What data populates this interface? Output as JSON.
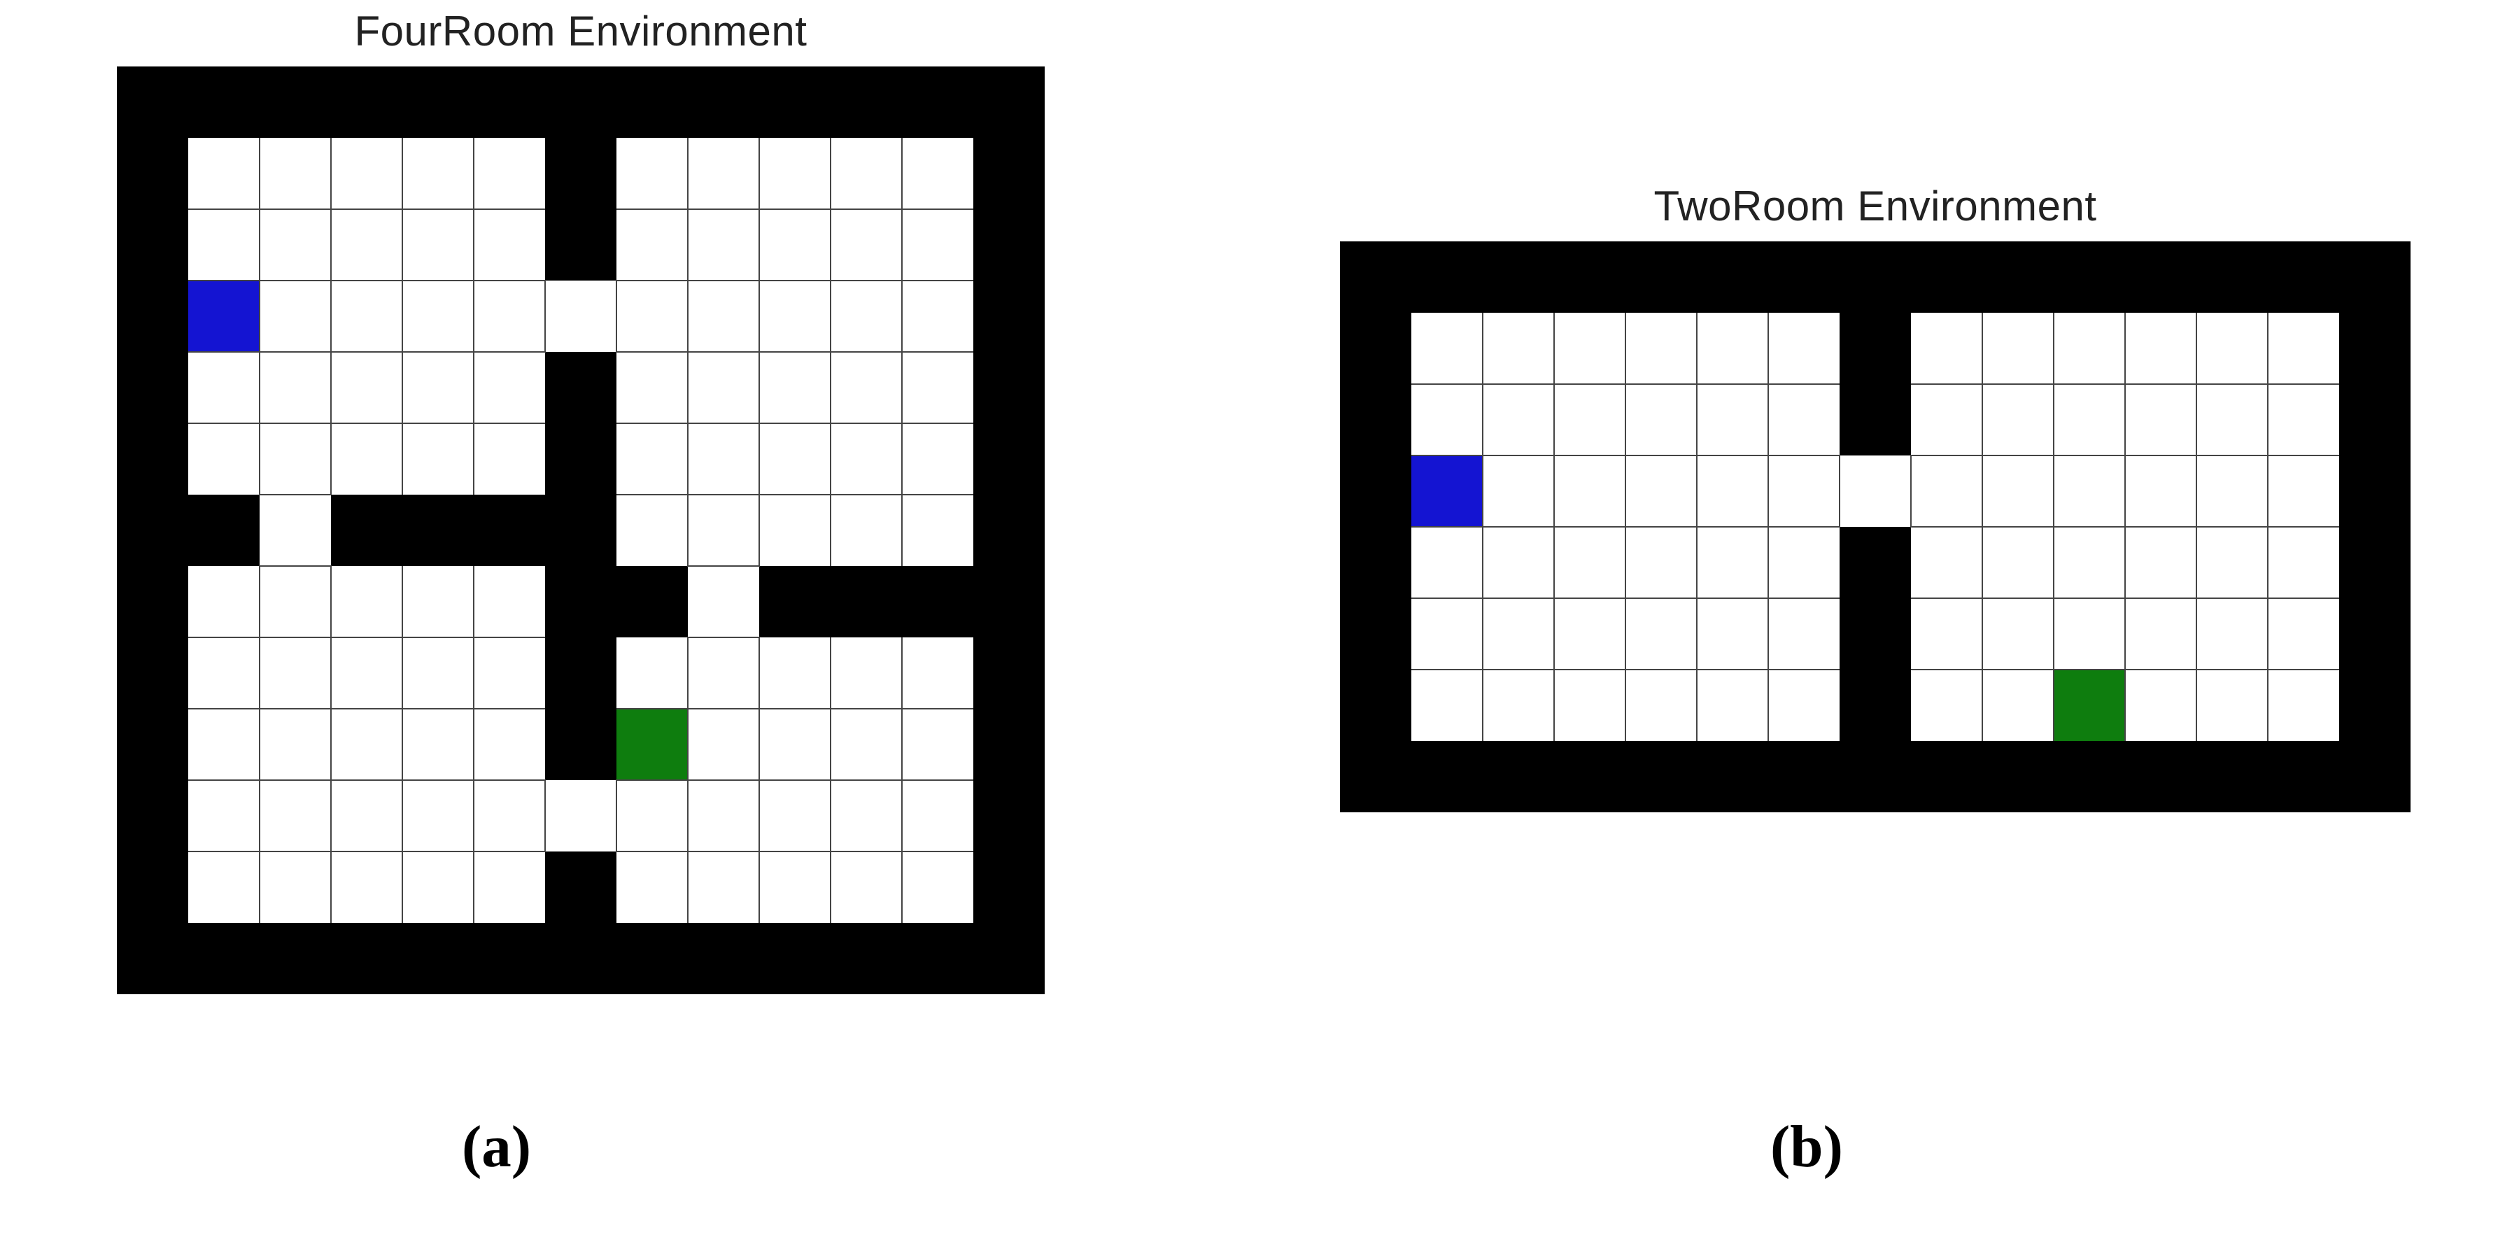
{
  "colors": {
    "wall": "#000000",
    "empty": "#ffffff",
    "agent": "#1414d2",
    "goal": "#0e7d0e",
    "grid_line": "#444444"
  },
  "panels": {
    "a": {
      "title": "FourRoom Environment",
      "sublabel": "(a)",
      "cell_size": 102,
      "grid": {
        "rows": 13,
        "cols": 13,
        "walls": [
          [
            0,
            0
          ],
          [
            0,
            1
          ],
          [
            0,
            2
          ],
          [
            0,
            3
          ],
          [
            0,
            4
          ],
          [
            0,
            5
          ],
          [
            0,
            6
          ],
          [
            0,
            7
          ],
          [
            0,
            8
          ],
          [
            0,
            9
          ],
          [
            0,
            10
          ],
          [
            0,
            11
          ],
          [
            0,
            12
          ],
          [
            1,
            0
          ],
          [
            1,
            6
          ],
          [
            1,
            12
          ],
          [
            2,
            0
          ],
          [
            2,
            6
          ],
          [
            2,
            12
          ],
          [
            3,
            0
          ],
          [
            3,
            12
          ],
          [
            4,
            0
          ],
          [
            4,
            6
          ],
          [
            4,
            12
          ],
          [
            5,
            0
          ],
          [
            5,
            6
          ],
          [
            5,
            12
          ],
          [
            6,
            0
          ],
          [
            6,
            1
          ],
          [
            6,
            3
          ],
          [
            6,
            4
          ],
          [
            6,
            5
          ],
          [
            6,
            6
          ],
          [
            6,
            12
          ],
          [
            7,
            0
          ],
          [
            7,
            6
          ],
          [
            7,
            7
          ],
          [
            7,
            9
          ],
          [
            7,
            10
          ],
          [
            7,
            11
          ],
          [
            7,
            12
          ],
          [
            8,
            0
          ],
          [
            8,
            6
          ],
          [
            8,
            12
          ],
          [
            9,
            0
          ],
          [
            9,
            6
          ],
          [
            9,
            12
          ],
          [
            10,
            0
          ],
          [
            10,
            12
          ],
          [
            11,
            0
          ],
          [
            11,
            6
          ],
          [
            11,
            12
          ],
          [
            12,
            0
          ],
          [
            12,
            1
          ],
          [
            12,
            2
          ],
          [
            12,
            3
          ],
          [
            12,
            4
          ],
          [
            12,
            5
          ],
          [
            12,
            6
          ],
          [
            12,
            7
          ],
          [
            12,
            8
          ],
          [
            12,
            9
          ],
          [
            12,
            10
          ],
          [
            12,
            11
          ],
          [
            12,
            12
          ]
        ],
        "agent": [
          3,
          1
        ],
        "goal": [
          9,
          7
        ]
      }
    },
    "b": {
      "title": "TwoRoom Environment",
      "sublabel": "(b)",
      "cell_size": 102,
      "grid": {
        "rows": 8,
        "cols": 15,
        "walls": [
          [
            0,
            0
          ],
          [
            0,
            1
          ],
          [
            0,
            2
          ],
          [
            0,
            3
          ],
          [
            0,
            4
          ],
          [
            0,
            5
          ],
          [
            0,
            6
          ],
          [
            0,
            7
          ],
          [
            0,
            8
          ],
          [
            0,
            9
          ],
          [
            0,
            10
          ],
          [
            0,
            11
          ],
          [
            0,
            12
          ],
          [
            0,
            13
          ],
          [
            0,
            14
          ],
          [
            1,
            0
          ],
          [
            1,
            7
          ],
          [
            1,
            14
          ],
          [
            2,
            0
          ],
          [
            2,
            7
          ],
          [
            2,
            14
          ],
          [
            3,
            0
          ],
          [
            3,
            14
          ],
          [
            4,
            0
          ],
          [
            4,
            7
          ],
          [
            4,
            14
          ],
          [
            5,
            0
          ],
          [
            5,
            7
          ],
          [
            5,
            14
          ],
          [
            6,
            0
          ],
          [
            6,
            7
          ],
          [
            6,
            14
          ],
          [
            7,
            0
          ],
          [
            7,
            1
          ],
          [
            7,
            2
          ],
          [
            7,
            3
          ],
          [
            7,
            4
          ],
          [
            7,
            5
          ],
          [
            7,
            6
          ],
          [
            7,
            7
          ],
          [
            7,
            8
          ],
          [
            7,
            9
          ],
          [
            7,
            10
          ],
          [
            7,
            11
          ],
          [
            7,
            12
          ],
          [
            7,
            13
          ],
          [
            7,
            14
          ]
        ],
        "agent": [
          3,
          1
        ],
        "goal": [
          6,
          10
        ]
      }
    }
  }
}
